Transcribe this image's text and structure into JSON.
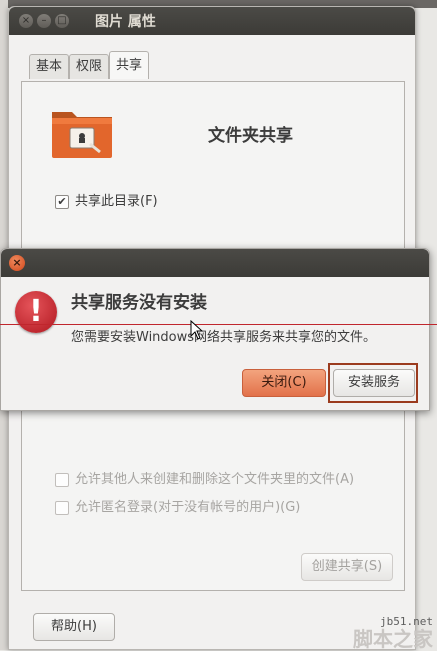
{
  "window": {
    "title": "图片 属性",
    "tabs": [
      "基本",
      "权限",
      "共享"
    ],
    "active_tab": "共享"
  },
  "share_panel": {
    "heading": "文件夹共享",
    "share_folder_label": "共享此目录(F)",
    "share_folder_checked": true,
    "allow_others_label": "允许其他人来创建和删除这个文件夹里的文件(A)",
    "guest_access_label": "允许匿名登录(对于没有帐号的用户)(G)",
    "create_share_button": "创建共享(S)",
    "help_button": "帮助(H)"
  },
  "dialog": {
    "heading": "共享服务没有安装",
    "body": "您需要安装Windows网络共享服务来共享您的文件。",
    "close_button": "关闭(C)",
    "install_button": "安装服务",
    "icon": "error-icon"
  },
  "watermark": {
    "domain": "jb51.net",
    "name": "脚本之家"
  },
  "colors": {
    "titlebar": "#3c3b37",
    "accent": "#e2714a",
    "error": "#b0171f",
    "highlight_border": "#9b3b1e"
  }
}
